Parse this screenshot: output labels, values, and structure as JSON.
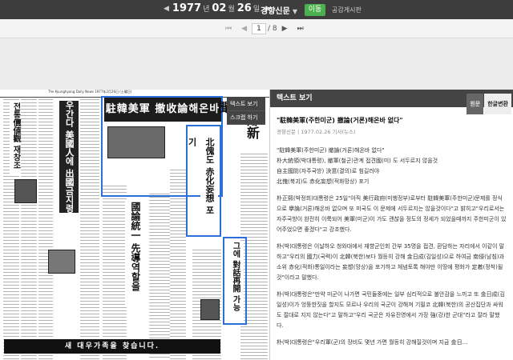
{
  "topbar": {
    "prev_arrow": "◀",
    "next_arrow": "▶",
    "year": "1977",
    "year_unit": "년",
    "month": "02",
    "month_unit": "월",
    "day": "26",
    "day_unit": "일",
    "newspaper": "경향신문",
    "go_button": "이동",
    "search_link": "공감게시판"
  },
  "pager": {
    "first": "⏮",
    "prev": "◀",
    "current": "1",
    "total": "/ 8",
    "next": "▶",
    "last": "⏭"
  },
  "viewer": {
    "masthead": "The Kyunghyang Daily News    1977年2月26日 (土曜日)",
    "headline_main": "駐韓美軍 撤收論해온바 없다",
    "left_vertical_1": "우간다 美國人에 出國금지령",
    "left_vertical_2": "전통價値觀 재창조",
    "center_vertical_1": "北傀도 赤化妄想 포기",
    "center_vertical_2": "國論統一 先導역할을",
    "right_vertical_1": "그에 對話再開 가능",
    "right_masthead": "京鄕新聞",
    "banner": "새 대우가족을 찾습니다.",
    "menu": [
      "텍스트 보기",
      "스크랩 하기"
    ]
  },
  "textpanel": {
    "header": "텍스트 보기",
    "tabs": [
      "원문",
      "한글변환"
    ],
    "title": "\"駐韓美軍(주한미군) 撤論(거론)해온바 없다\"",
    "meta": "경향신문 | 1977.02.26 기사(뉴스)",
    "para1": [
      "\"駐韓美軍(주한미군) 撤論(거론)해온바 없다\"",
      "朴大統領(박대통령), 撤軍(철군)관계 접견國(미) 도 서두르지 않을것",
      "自主國防(자주국방) 決意(결의)로 힘길러야",
      "北傀(북괴)도 赤化妄想(적화망상) 포기"
    ],
    "para2": "朴正熙(박정희)대통령은 25일\"아직 美行政府(미행정부)로부터 駐韓美軍(주한미군)문제를 정식으로 擧論(거론)해온바 없으며 또 미국도 이 문제에 서두르지는 않을것이다\"고 밝히고\"우리로서는 자주국방이 완전히 이룩되어 美軍(미군)이 가도 괜찮을 정도의 정세가 되었을때까지 주한미군이 있어주었으면 좋겠다\"고 강조했다.",
    "para3": "朴(박)대통령은 이날하오 청와대에서 재향군인회 간부 35명을 접견, 환담하는 자리에서 이같이 말하고\"우리의 國力(국력)이 北韓(북한)보다 월등히 강해 金日成(김일성)으로 하여금 南侵(남침)과 소위 赤化(적화)통일이라는 妄想(망상)을 포기하고 체념토록 해야만 이땅에 평화가 定着(정착)될것\"이라고 말했다.",
    "para4": "朴(박)대통령은\"만약 미군이 나가면 국민들중에는 일부 심리적으로 불안감을 느끼고 또 金日成(김일성)이가 엉뚱한짓을 할지도 모르나 우리의 국군이 강해져 기필코 北韓(북한)의 공산집단과 싸워도 절대로 지지 않는다\"고 말하고\"우리 국군은 자유진영에서 가장 強(강)한 군대\"라고 잘라 말했다.",
    "para5": "朴(박)대통령은\"우리軍(군)의 장비도 몇년 가면 월등히 강해질것이며 지금 金日..."
  }
}
